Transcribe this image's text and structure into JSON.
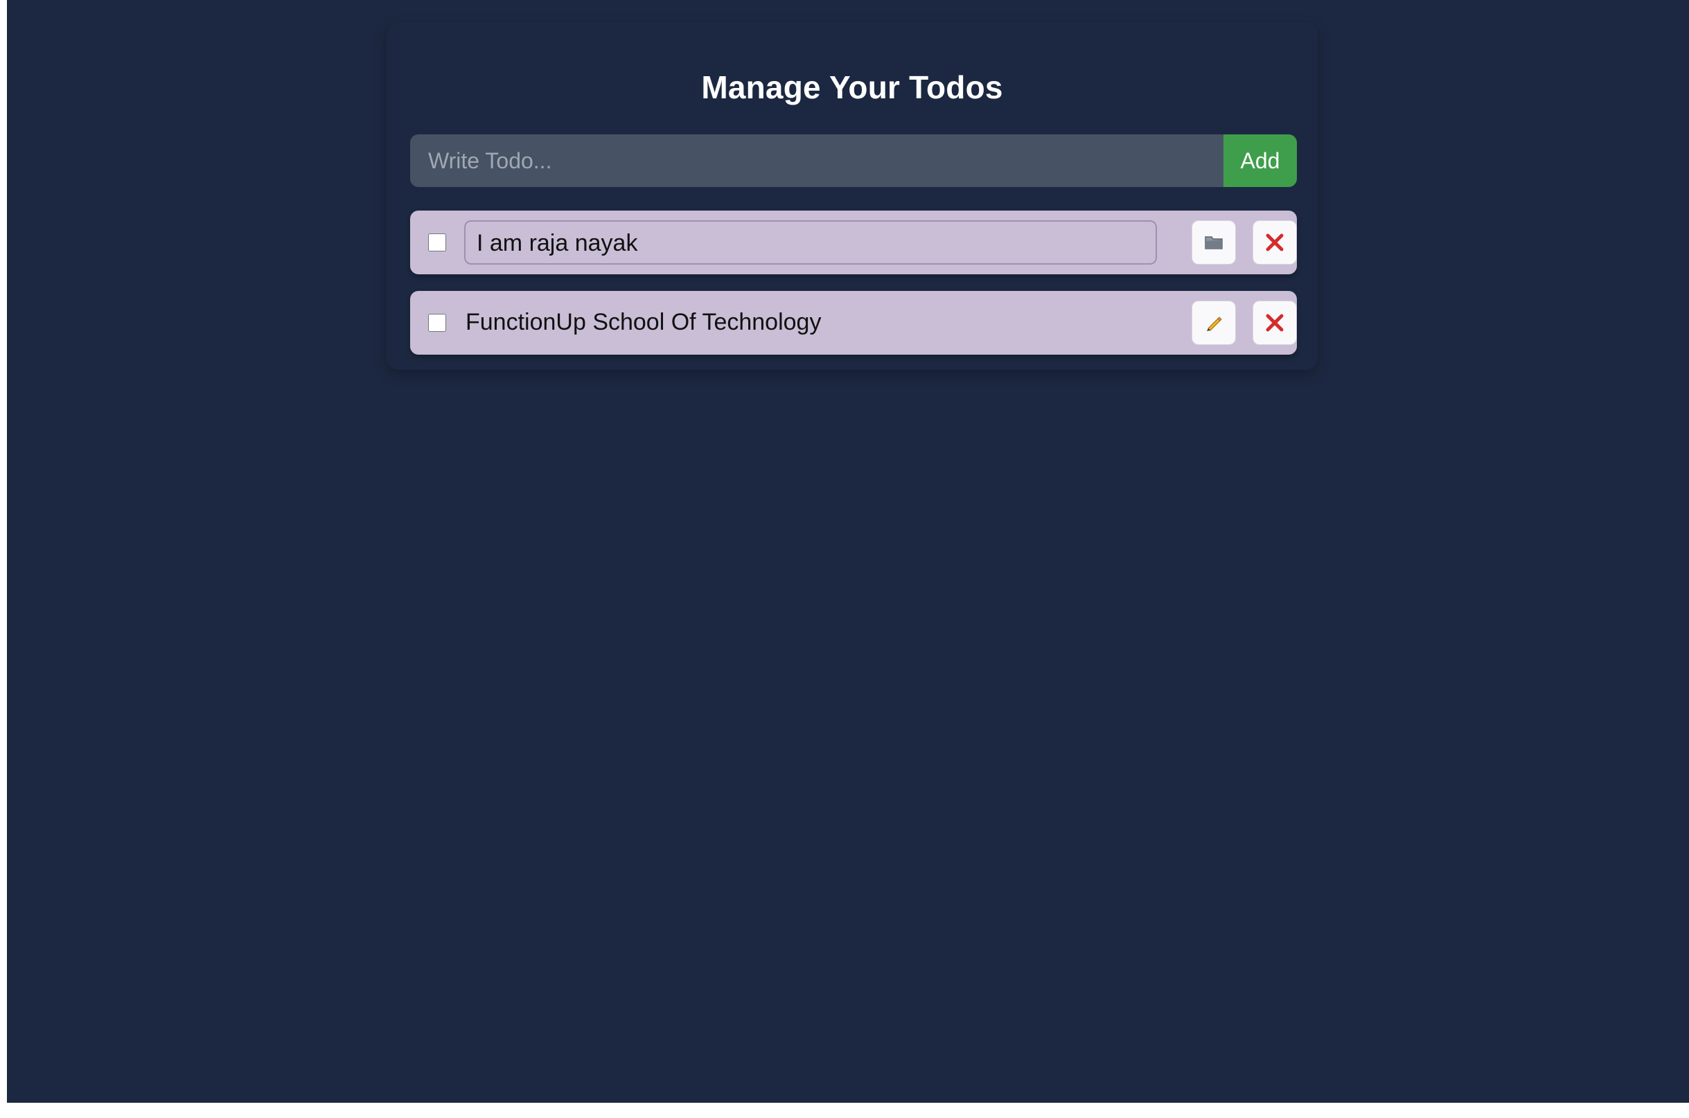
{
  "app": {
    "title": "Manage Your Todos"
  },
  "form": {
    "placeholder": "Write Todo...",
    "add_label": "Add"
  },
  "todos": [
    {
      "text": "I am raja nayak",
      "completed": false,
      "editing": true,
      "action_icon": "folder-icon"
    },
    {
      "text": "FunctionUp School Of Technology",
      "completed": false,
      "editing": false,
      "action_icon": "pencil-icon"
    }
  ],
  "colors": {
    "background": "#1c2841",
    "input_bg": "#475264",
    "add_button": "#3f9e4b",
    "todo_item_bg": "#c9bed6",
    "delete_icon": "#d42b2b"
  }
}
